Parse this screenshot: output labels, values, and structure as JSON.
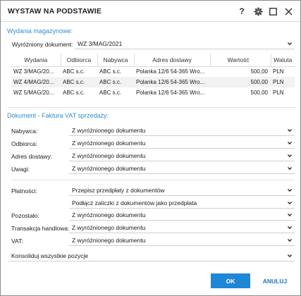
{
  "window": {
    "title": "WYSTAW NA PODSTAWIE",
    "help_label": "?",
    "icons": [
      "gear-icon",
      "maximize-icon",
      "close-icon"
    ]
  },
  "warehouse": {
    "section_title": "Wydania magazynowe:",
    "highlighted_label": "Wyróżniony dokument:",
    "highlighted_value": "WZ 3/MAG/2021",
    "columns": [
      "Wydania",
      "Odbiorca",
      "Nabywca",
      "Adres dostawy",
      "Wartość",
      "Waluta"
    ],
    "rows": [
      {
        "doc": "WZ 3/MAG/20...",
        "recipient": "ABC s.c.",
        "buyer": "ABC s.c.",
        "address": "Polanka  12/6  54-365 Wro...",
        "value": "500,00",
        "currency": "PLN"
      },
      {
        "doc": "WZ 4/MAG/20...",
        "recipient": "ABC s.c.",
        "buyer": "ABC s.c.",
        "address": "Polanka  12/6  54-365 Wro...",
        "value": "500,00",
        "currency": "PLN"
      },
      {
        "doc": "WZ 5/MAG/20...",
        "recipient": "ABC s.c.",
        "buyer": "ABC s.c.",
        "address": "Polanka  12/6  54-365 Wro...",
        "value": "500,00",
        "currency": "PLN"
      }
    ]
  },
  "document": {
    "section_title": "Dokument - Faktura VAT sprzedaży:",
    "buyer_label": "Nabywca:",
    "buyer_value": "Z wyróżnionego dokumentu",
    "recipient_label": "Odbiorca:",
    "recipient_value": "Z wyróżnionego dokumentu",
    "address_label": "Adres dostawy:",
    "address_value": "Z wyróżnionego dokumentu",
    "notes_label": "Uwagi:",
    "notes_value": "Z wyróżnionego dokumentu",
    "payments_label": "Płatności:",
    "payments_value": "Przepisz przedpłaty z dokumentów",
    "advance_value": "Podłącz zaliczki z dokumentów jako przedpłata",
    "other_label": "Pozostało:",
    "other_value": "Z wyróżnionego dokumentu",
    "transaction_label": "Transakcja handlowa:",
    "transaction_value": "Z wyróżnionego dokumentu",
    "vat_label": "VAT:",
    "vat_value": "Z wyróżnionego dokumentu",
    "consolidate_value": "Konsoliduj wszystkie pozycje"
  },
  "buttons": {
    "ok": "OK",
    "cancel": "ANULUJ"
  },
  "colors": {
    "accent": "#2f8dcf",
    "primary_button": "#1e86d6",
    "row_stripe": "#f2f2f2"
  }
}
